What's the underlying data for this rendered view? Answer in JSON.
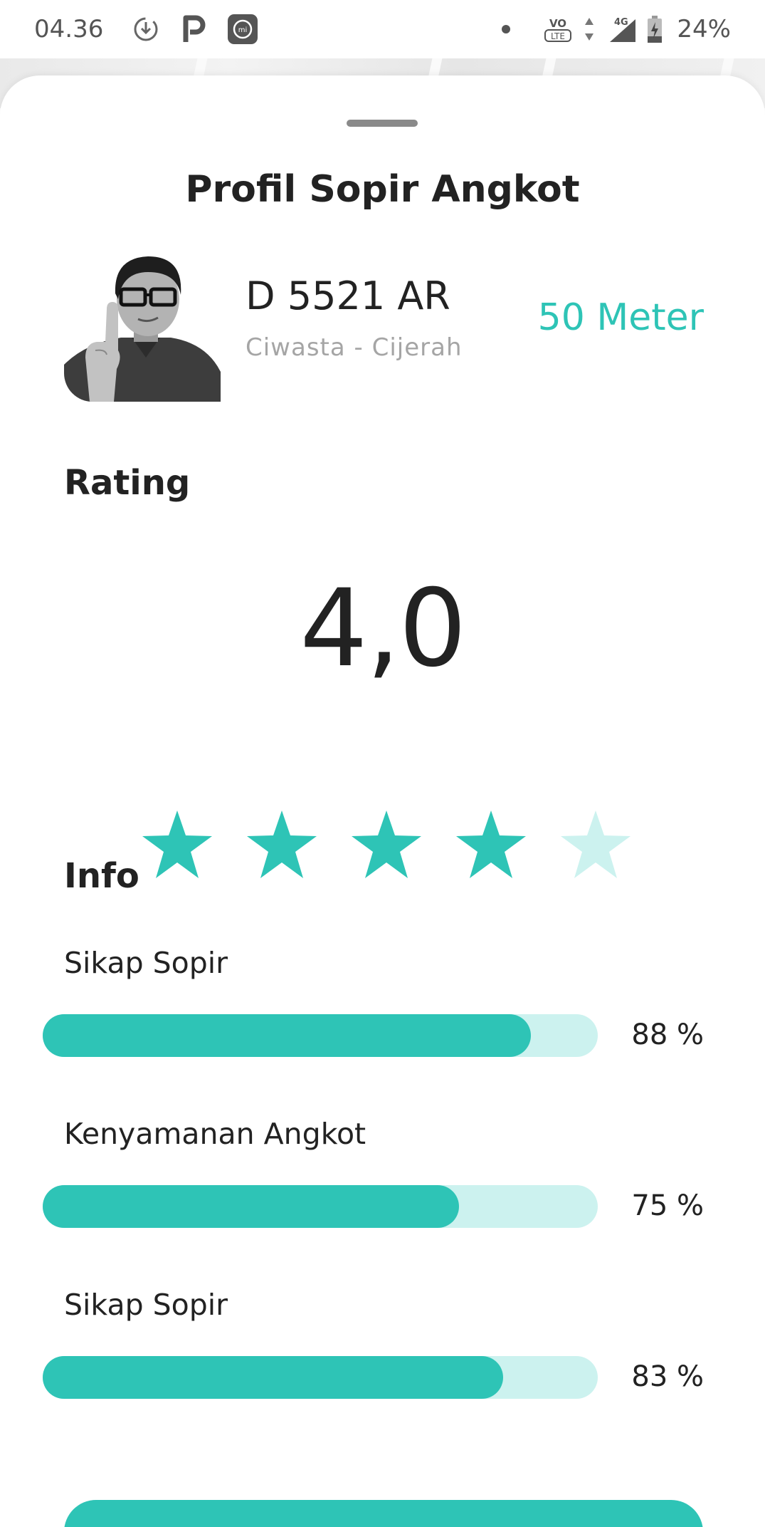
{
  "status_bar": {
    "time": "04.36",
    "battery_percent": "24%",
    "network": "4G",
    "icons": [
      "download-icon",
      "parking-p-icon",
      "mi-icon",
      "volte-icon",
      "data-arrows-icon",
      "signal-icon",
      "battery-charging-icon"
    ]
  },
  "sheet": {
    "title": "Profil Sopir Angkot"
  },
  "profile": {
    "plate_number": "D 5521 AR",
    "route": "Ciwasta - Cijerah",
    "distance": "50 Meter"
  },
  "rating": {
    "heading": "Rating",
    "value": "4,0",
    "stars_filled": 4,
    "stars_total": 5
  },
  "info": {
    "heading": "Info",
    "items": [
      {
        "label": "Sikap Sopir",
        "percent_text": "88 %",
        "fraction": 0.88
      },
      {
        "label": "Kenyamanan Angkot",
        "percent_text": "75 %",
        "fraction": 0.75
      },
      {
        "label": "Sikap Sopir",
        "percent_text": "83 %",
        "fraction": 0.83
      }
    ]
  },
  "colors": {
    "accent": "#2ec4b6",
    "accent_light": "#ccf2ef",
    "text": "#222222",
    "muted": "#a5a5a5"
  }
}
